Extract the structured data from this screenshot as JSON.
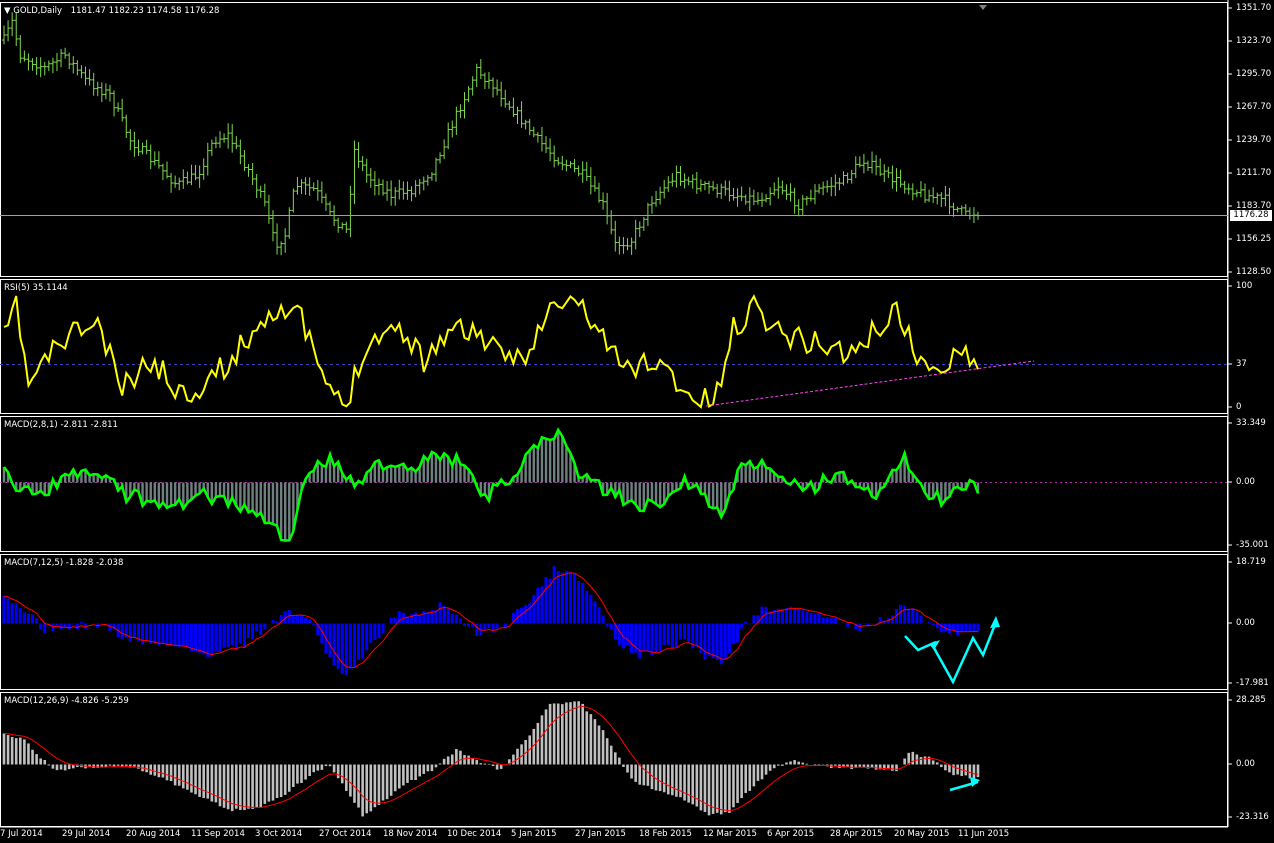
{
  "main_pane": {
    "symbol": "GOLD,Daily",
    "ohlc": "1181.47 1182.23 1174.58 1176.28",
    "current_price": "1176.28",
    "price_ticks": [
      "1351.70",
      "1323.70",
      "1295.70",
      "1267.70",
      "1239.70",
      "1211.70",
      "1183.70",
      "1156.25",
      "1128.50"
    ]
  },
  "rsi_pane": {
    "label": "RSI(5) 35.1144",
    "ticks": [
      "100",
      "37",
      "0"
    ],
    "line_color": "#ffff00"
  },
  "macd1_pane": {
    "label": "MACD(2,8,1) -2.811 -2.811",
    "ticks": [
      "33.349",
      "0.00",
      "-35.001"
    ],
    "line_color": "#00ff00",
    "hist_color": "#708080"
  },
  "macd2_pane": {
    "label": "MACD(7,12,5) -1.828 -2.038",
    "ticks": [
      "18.719",
      "0.00",
      "-17.981"
    ],
    "hist_color": "#0000ff",
    "signal_color": "#ff0000",
    "annotation_color": "#00ffff"
  },
  "macd3_pane": {
    "label": "MACD(12,26,9) -4.826 -5.259",
    "ticks": [
      "28.285",
      "0.00",
      "-23.316"
    ],
    "hist_color": "#c0c0c0",
    "signal_color": "#ff0000"
  },
  "date_ticks": [
    "7 Jul 2014",
    "29 Jul 2014",
    "20 Aug 2014",
    "11 Sep 2014",
    "3 Oct 2014",
    "27 Oct 2014",
    "18 Nov 2014",
    "10 Dec 2014",
    "5 Jan 2015",
    "27 Jan 2015",
    "18 Feb 2015",
    "12 Mar 2015",
    "6 Apr 2015",
    "28 Apr 2015",
    "20 May 2015",
    "11 Jun 2015"
  ]
}
